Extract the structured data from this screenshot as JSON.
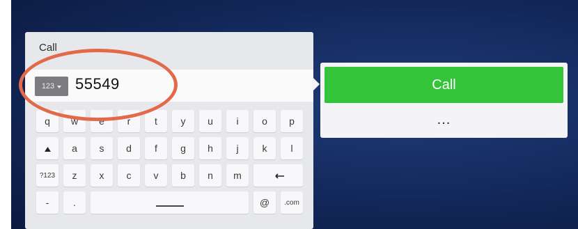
{
  "dialog": {
    "title": "Call",
    "input_mode": "123",
    "input_value": "55549"
  },
  "keyboard": {
    "row1": [
      "q",
      "w",
      "e",
      "r",
      "t",
      "y",
      "u",
      "i",
      "o",
      "p"
    ],
    "row2": [
      "a",
      "s",
      "d",
      "f",
      "g",
      "h",
      "j",
      "k",
      "l"
    ],
    "row3": [
      "z",
      "x",
      "c",
      "v",
      "b",
      "n",
      "m"
    ],
    "symbols_label": "?123",
    "dash_label": "-",
    "dot_label": ".",
    "at_label": "@",
    "dotcom_label": ".com"
  },
  "actions": {
    "call_label": "Call",
    "more_label": "..."
  },
  "colors": {
    "call_green": "#33c43a",
    "highlight_orange": "#e2694a",
    "background_navy": "#13285a"
  },
  "icons": {
    "shift": "shift-icon",
    "backspace": "backspace-icon",
    "dropdown": "chevron-down-icon"
  }
}
